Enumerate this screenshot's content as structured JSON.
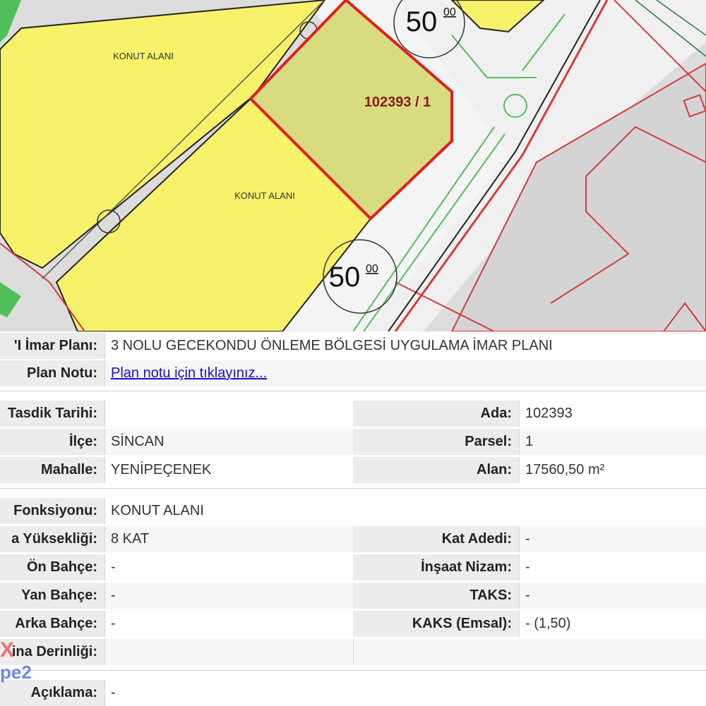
{
  "map": {
    "parcel_label": "102393 / 1",
    "road_width_top": "50",
    "road_width_top_sup": "00",
    "road_width_bottom": "50",
    "road_width_bottom_sup": "00",
    "zone_upper": {
      "name": "KONUT ALANI"
    },
    "zone_lower": {
      "name": "KONUT ALANI"
    },
    "colors": {
      "residential": "#f7f26a",
      "parcel_fill": "#d7dc80",
      "parcel_border": "#e11e1e",
      "road": "#ffffff",
      "green": "#4fbf5a",
      "background": "#dcdcdc"
    }
  },
  "info": {
    "plan": {
      "label": "'I İmar Planı:",
      "value": "3 NOLU GECEKONDU ÖNLEME BÖLGESİ UYGULAMA İMAR PLANI"
    },
    "plan_note": {
      "label": "Plan Notu:",
      "link": "Plan notu için tıklayınız..."
    },
    "approval": {
      "label": "Tasdik Tarihi:",
      "value": ""
    },
    "block": {
      "label": "Ada:",
      "value": "102393"
    },
    "district": {
      "label": "İlçe:",
      "value": "SİNCAN"
    },
    "parcel": {
      "label": "Parsel:",
      "value": "1"
    },
    "neighborhood": {
      "label": "Mahalle:",
      "value": "YENİPEÇENEK"
    },
    "area": {
      "label": "Alan:",
      "value": "17560,50 m²"
    },
    "function": {
      "label": "Fonksiyonu:",
      "value": "KONUT ALANI"
    },
    "height": {
      "label": "a Yüksekliği:",
      "value": "8 KAT"
    },
    "floors": {
      "label": "Kat Adedi:",
      "value": "-"
    },
    "front_yard": {
      "label": "Ön Bahçe:",
      "value": "-"
    },
    "construction_order": {
      "label": "İnşaat Nizam:",
      "value": "-"
    },
    "side_yard": {
      "label": "Yan Bahçe:",
      "value": "-"
    },
    "taks": {
      "label": "TAKS:",
      "value": "-"
    },
    "back_yard": {
      "label": "Arka Bahçe:",
      "value": "-"
    },
    "kaks": {
      "label": "KAKS (Emsal):",
      "value": "- (1,50)"
    },
    "depth": {
      "label": "ina Derinliği:",
      "value": ""
    },
    "description": {
      "label": "Açıklama:",
      "value": "-"
    }
  },
  "watermark": {
    "line1": "X",
    "line2": "pe2"
  }
}
